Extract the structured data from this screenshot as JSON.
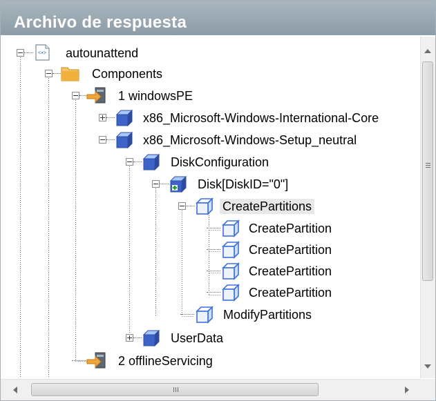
{
  "panel": {
    "title": "Archivo de respuesta"
  },
  "tree": {
    "selected": "CreatePartitions",
    "nodes": [
      {
        "label": "autounattend",
        "icon": "answer-file-icon",
        "expander": "minus"
      },
      {
        "label": "Components",
        "icon": "folder-icon",
        "expander": "minus"
      },
      {
        "label": "1 windowsPE",
        "icon": "configuration-pass-icon",
        "expander": "minus"
      },
      {
        "label": "x86_Microsoft-Windows-International-Core",
        "icon": "component-cube-icon",
        "expander": "plus"
      },
      {
        "label": "x86_Microsoft-Windows-Setup_neutral",
        "icon": "component-cube-icon",
        "expander": "minus"
      },
      {
        "label": "DiskConfiguration",
        "icon": "setting-cube-icon",
        "expander": "minus"
      },
      {
        "label": "Disk[DiskID=\"0\"]",
        "icon": "list-item-cube-icon",
        "expander": "minus"
      },
      {
        "label": "CreatePartitions",
        "icon": "collection-cube-icon",
        "expander": "minus"
      },
      {
        "label": "CreatePartition",
        "icon": "collection-cube-icon",
        "expander": "none"
      },
      {
        "label": "CreatePartition",
        "icon": "collection-cube-icon",
        "expander": "none"
      },
      {
        "label": "CreatePartition",
        "icon": "collection-cube-icon",
        "expander": "none"
      },
      {
        "label": "CreatePartition",
        "icon": "collection-cube-icon",
        "expander": "none"
      },
      {
        "label": "ModifyPartitions",
        "icon": "collection-cube-icon",
        "expander": "none"
      },
      {
        "label": "UserData",
        "icon": "setting-cube-icon",
        "expander": "plus"
      },
      {
        "label": "2 offlineServicing",
        "icon": "configuration-pass-icon",
        "expander": "none"
      }
    ]
  },
  "scrollbars": {
    "vertical": {
      "up": "scroll-up-icon",
      "down": "scroll-down-icon"
    },
    "horizontal": {
      "left": "scroll-left-icon",
      "right": "scroll-right-icon"
    }
  },
  "colors": {
    "titlebar": "#9aa8b2",
    "cube_dark": "#3d63c9",
    "cube_light": "#a9c8ff",
    "folder": "#f2b13c",
    "pass_arrow": "#e8a23a"
  }
}
